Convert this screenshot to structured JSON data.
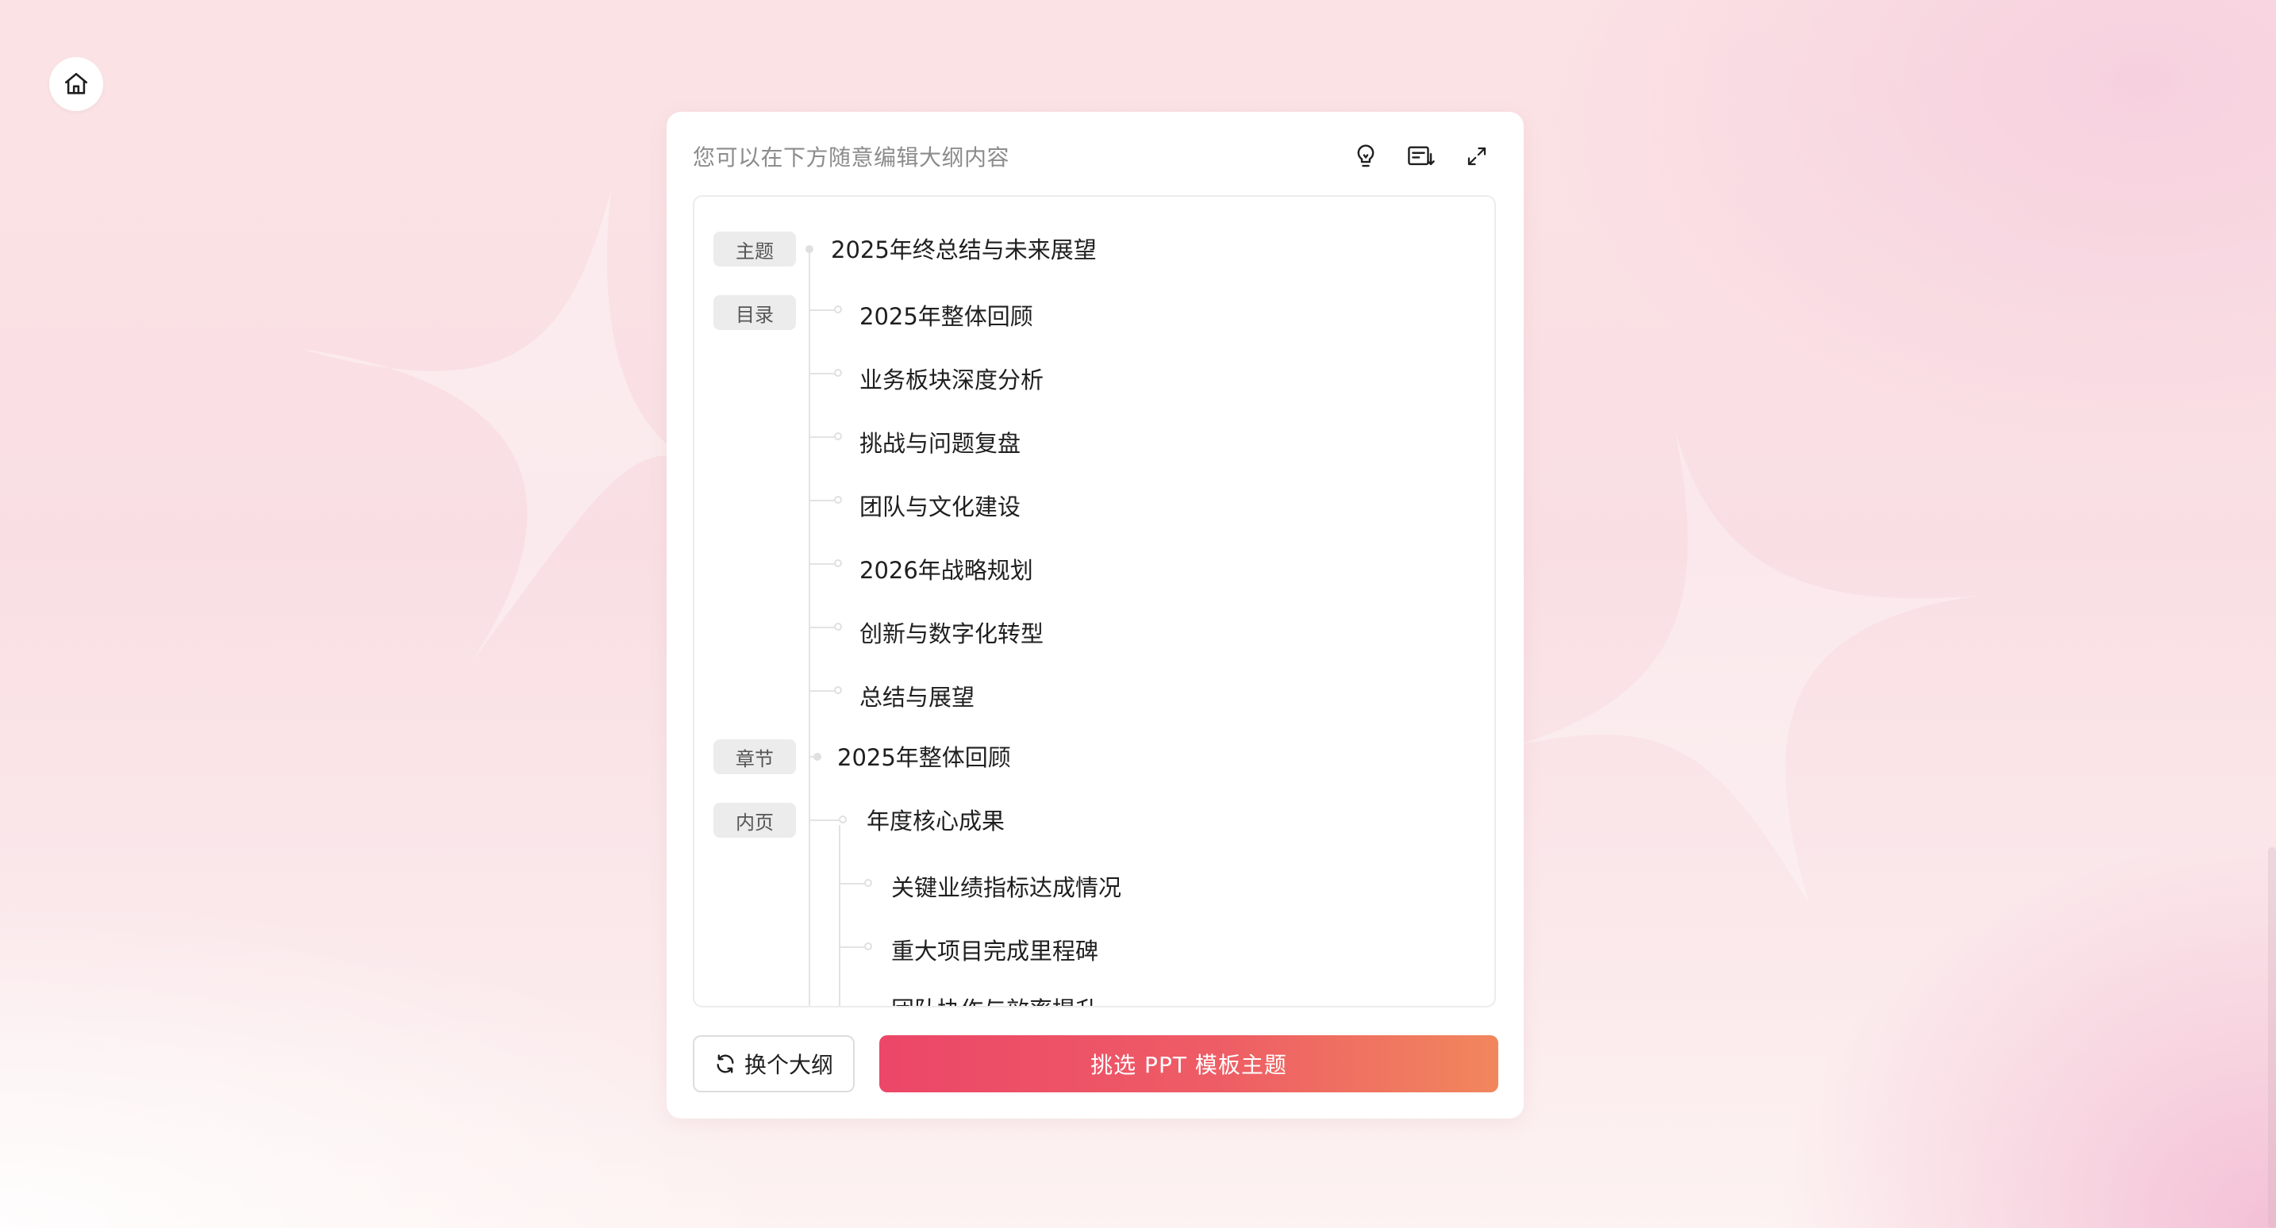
{
  "card": {
    "hint": "您可以在下方随意编辑大纲内容",
    "icons": [
      "lightbulb-icon",
      "outline-insert-icon",
      "expand-icon"
    ]
  },
  "outline": {
    "tags": {
      "theme": "主题",
      "toc": "目录",
      "chapter": "章节",
      "page": "内页"
    },
    "theme_title": "2025年终总结与未来展望",
    "toc_items": [
      "2025年整体回顾",
      "业务板块深度分析",
      "挑战与问题复盘",
      "团队与文化建设",
      "2026年战略规划",
      "创新与数字化转型",
      "总结与展望"
    ],
    "chapter_title": "2025年整体回顾",
    "page_title": "年度核心成果",
    "page_items": [
      "关键业绩指标达成情况",
      "重大项目完成里程碑",
      "团队协作与效率提升"
    ]
  },
  "actions": {
    "regenerate_label": "换个大纲",
    "choose_template_label": "挑选 PPT 模板主题"
  },
  "colors": {
    "accent_start": "#ec4668",
    "accent_end": "#f1875d",
    "tag_bg": "#ececec"
  }
}
